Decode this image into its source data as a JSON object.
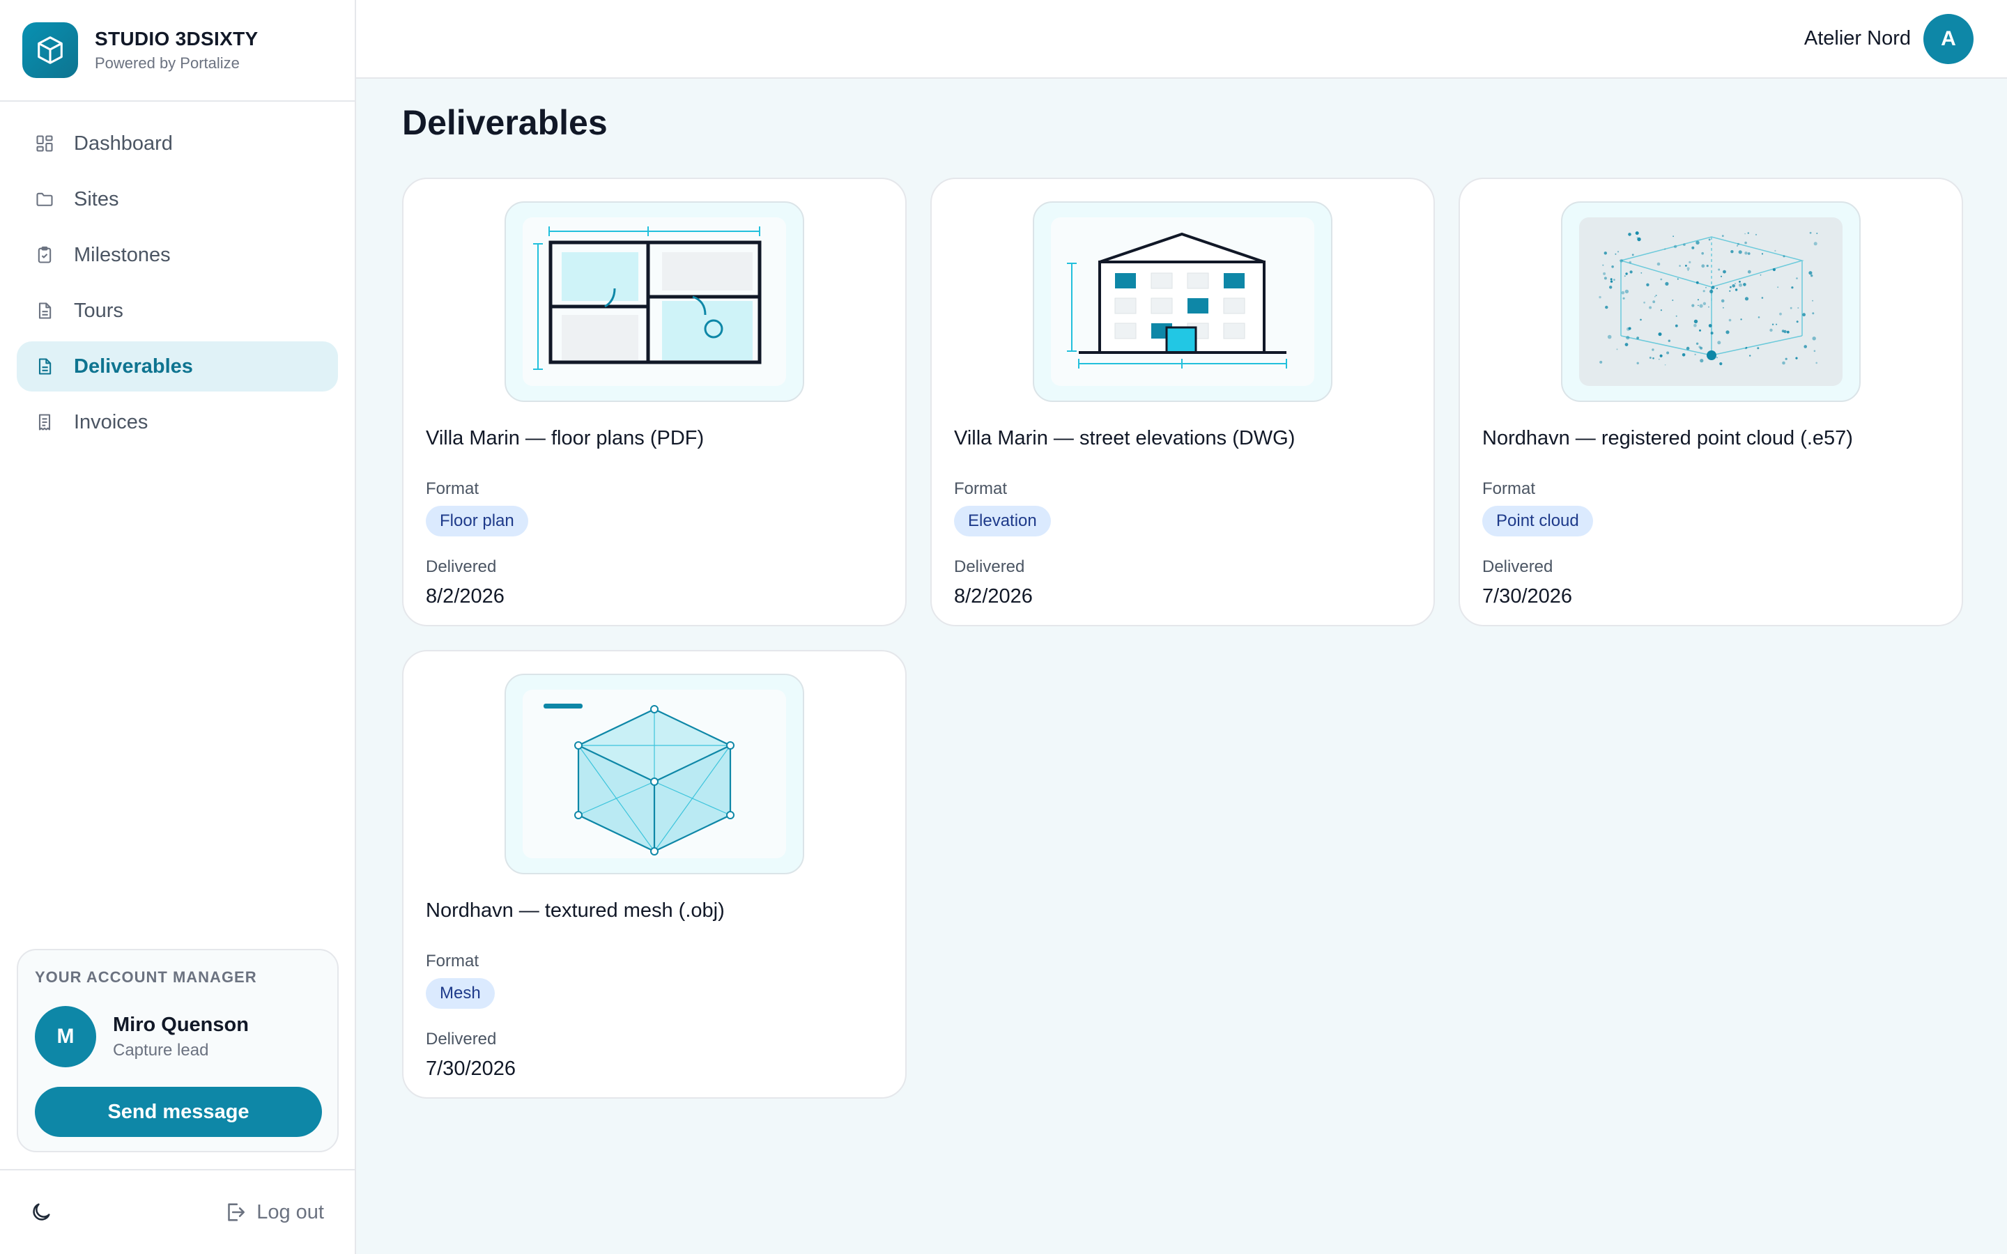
{
  "brand": {
    "name": "STUDIO 3DSIXTY",
    "subtitle": "Powered by Portalize"
  },
  "nav": {
    "items": [
      {
        "label": "Dashboard",
        "icon": "dashboard-icon"
      },
      {
        "label": "Sites",
        "icon": "folder-icon"
      },
      {
        "label": "Milestones",
        "icon": "clipboard-check-icon"
      },
      {
        "label": "Tours",
        "icon": "document-icon"
      },
      {
        "label": "Deliverables",
        "icon": "document-icon",
        "active": true
      },
      {
        "label": "Invoices",
        "icon": "receipt-icon"
      }
    ]
  },
  "account_manager": {
    "heading": "YOUR ACCOUNT MANAGER",
    "initial": "M",
    "name": "Miro Quenson",
    "role": "Capture lead",
    "button_label": "Send message"
  },
  "footer": {
    "theme_icon": "moon-icon",
    "logout_label": "Log out"
  },
  "topbar": {
    "org_name": "Atelier Nord",
    "org_initial": "A"
  },
  "page": {
    "title": "Deliverables"
  },
  "labels": {
    "format": "Format",
    "delivered": "Delivered"
  },
  "deliverables": [
    {
      "title": "Villa Marin — floor plans (PDF)",
      "format": "Floor plan",
      "delivered": "8/2/2026",
      "thumb": "floor-plan-thumbnail"
    },
    {
      "title": "Villa Marin — street elevations (DWG)",
      "format": "Elevation",
      "delivered": "8/2/2026",
      "thumb": "elevation-thumbnail"
    },
    {
      "title": "Nordhavn — registered point cloud (.e57)",
      "format": "Point cloud",
      "delivered": "7/30/2026",
      "thumb": "point-cloud-thumbnail"
    },
    {
      "title": "Nordhavn — textured mesh (.obj)",
      "format": "Mesh",
      "delivered": "7/30/2026",
      "thumb": "mesh-thumbnail"
    }
  ],
  "colors": {
    "accent": "#0e87a7",
    "accent_light": "#e0f2f7",
    "badge_bg": "#dbeafe",
    "badge_text": "#1e3a8a",
    "page_bg": "#f1f8fa"
  }
}
